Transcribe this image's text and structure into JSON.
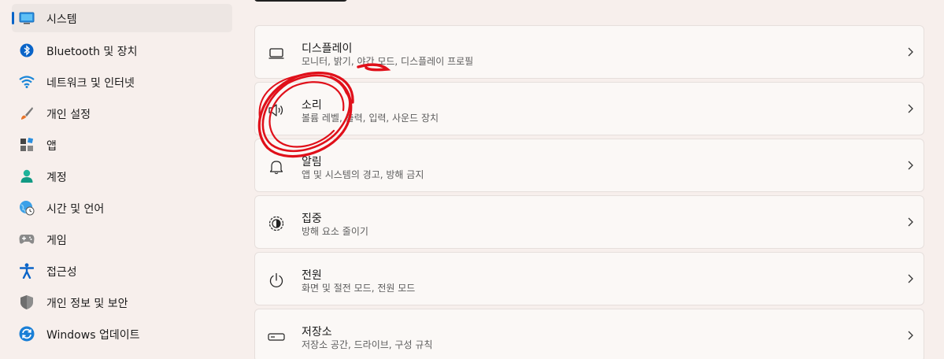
{
  "sidebar": {
    "items": [
      {
        "label": "시스템",
        "icon": "monitor-icon",
        "selected": true
      },
      {
        "label": "Bluetooth 및 장치",
        "icon": "bluetooth-icon"
      },
      {
        "label": "네트워크 및 인터넷",
        "icon": "wifi-icon"
      },
      {
        "label": "개인 설정",
        "icon": "brush-icon"
      },
      {
        "label": "앱",
        "icon": "apps-icon"
      },
      {
        "label": "계정",
        "icon": "person-icon"
      },
      {
        "label": "시간 및 언어",
        "icon": "globe-clock-icon"
      },
      {
        "label": "게임",
        "icon": "gamepad-icon"
      },
      {
        "label": "접근성",
        "icon": "accessibility-icon"
      },
      {
        "label": "개인 정보 및 보안",
        "icon": "shield-icon"
      },
      {
        "label": "Windows 업데이트",
        "icon": "sync-icon"
      }
    ]
  },
  "settings": [
    {
      "title": "디스플레이",
      "subtitle": "모니터, 밝기, 야간 모드, 디스플레이 프로필",
      "icon": "display-icon"
    },
    {
      "title": "소리",
      "subtitle": "볼륨 레벨, 출력, 입력, 사운드 장치",
      "icon": "speaker-icon"
    },
    {
      "title": "알림",
      "subtitle": "앱 및 시스템의 경고, 방해 금지",
      "icon": "bell-icon"
    },
    {
      "title": "집중",
      "subtitle": "방해 요소 줄이기",
      "icon": "focus-icon"
    },
    {
      "title": "전원",
      "subtitle": "화면 및 절전 모드, 전원 모드",
      "icon": "power-icon"
    },
    {
      "title": "저장소",
      "subtitle": "저장소 공간, 드라이브, 구성 규칙",
      "icon": "storage-icon"
    }
  ],
  "colors": {
    "accent": "#0a64c8",
    "annotation": "#e0101a",
    "background": "#f7efec"
  }
}
